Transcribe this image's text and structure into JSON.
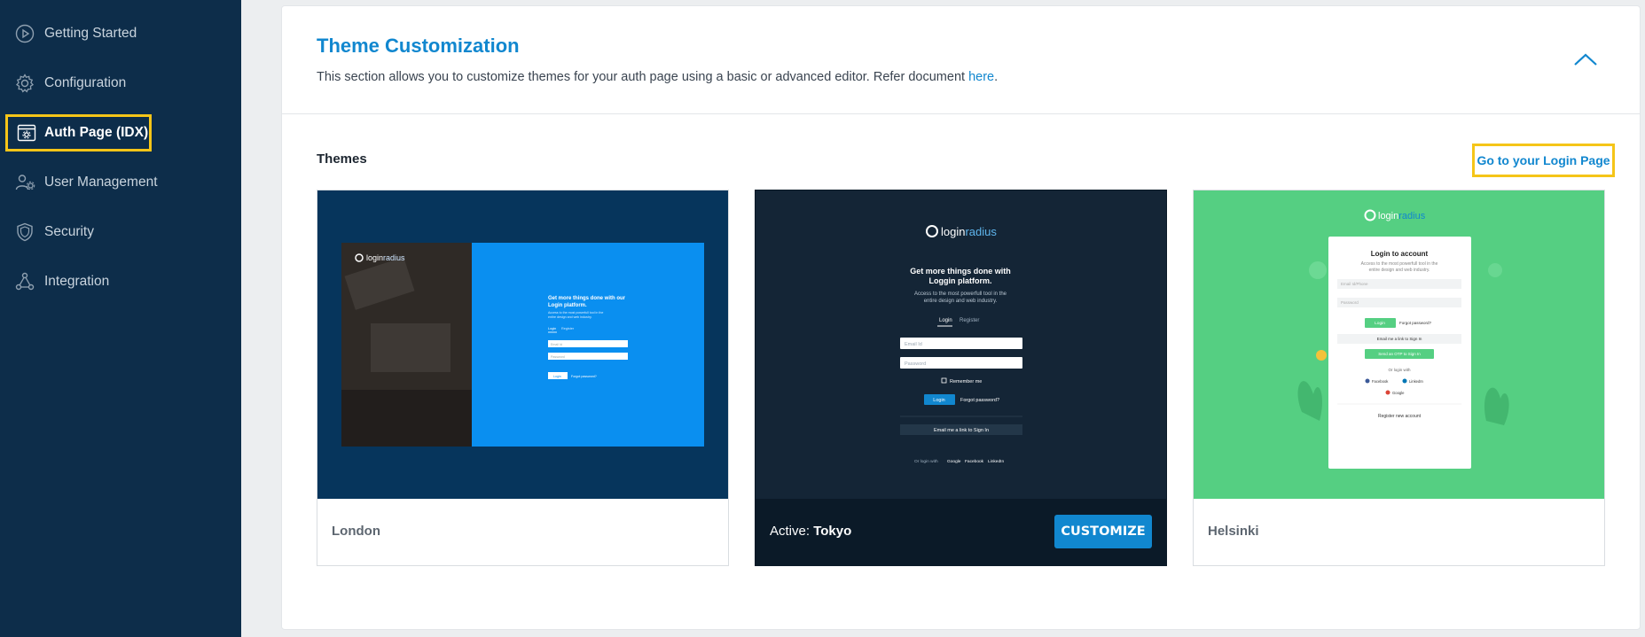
{
  "sidebar": {
    "items": [
      {
        "label": "Getting Started",
        "icon": "play-circle-icon"
      },
      {
        "label": "Configuration",
        "icon": "gear-icon"
      },
      {
        "label": "Auth Page (IDX)",
        "icon": "browser-gear-icon",
        "active": true
      },
      {
        "label": "User Management",
        "icon": "users-gear-icon"
      },
      {
        "label": "Security",
        "icon": "shield-icon"
      },
      {
        "label": "Integration",
        "icon": "integration-nodes-icon"
      }
    ]
  },
  "section": {
    "title": "Theme Customization",
    "description": "This section allows you to customize themes for your auth page using a basic or advanced editor. Refer document ",
    "link_text": "here",
    "description_end": ".",
    "collapse_icon": "chevron-up-icon"
  },
  "themes": {
    "heading": "Themes",
    "login_link": "Go to your Login Page",
    "cards": [
      {
        "name": "London",
        "active": false
      },
      {
        "active_prefix": "Active: ",
        "name": "Tokyo",
        "active": true,
        "button": "CUSTOMIZE"
      },
      {
        "name": "Helsinki",
        "active": false
      }
    ]
  },
  "previews": {
    "logo_a": "login",
    "logo_b": "radius",
    "london": {
      "headline_1": "Get more things done with our",
      "headline_2": "Login platform.",
      "sub_1": "Access to the most powerfull tool in the",
      "sub_2": "entire design and web industry.",
      "tab_login": "Login",
      "tab_register": "Register",
      "email": "Email Id",
      "password": "Password",
      "login_btn": "Login",
      "forgot": "Forgot password?"
    },
    "tokyo": {
      "headline_1": "Get more things done with",
      "headline_2": "Loggin platform.",
      "sub_1": "Access to the most powerfull tool in the",
      "sub_2": "entire design and web industry.",
      "tab_login": "Login",
      "tab_register": "Register",
      "email": "Email Id",
      "password": "Password",
      "remember": "Remember me",
      "login_btn": "Login",
      "forgot": "Forgot password?",
      "email_link": "Email me a link to Sign In",
      "or_login": "Or login with",
      "google": "Google",
      "facebook": "Facebook",
      "linkedin": "LinkedIn"
    },
    "helsinki": {
      "title": "Login to account",
      "sub_1": "Access to the most powerfull tool in the",
      "sub_2": "entire design and web industry.",
      "email": "Email Id/Phone",
      "password": "Password",
      "login_btn": "Login",
      "forgot": "Forgot password?",
      "email_link": "Email me a link to Sign In",
      "otp_btn": "Send an OTP to Sign In",
      "or_login": "Or login with",
      "facebook": "Facebook",
      "linkedin": "LinkedIn",
      "google": "Google",
      "register": "Register new account"
    }
  },
  "colors": {
    "sidebar_bg": "#0d2d4a",
    "accent": "#1187cf",
    "highlight": "#f5c518",
    "london_bg": "#06355c",
    "tokyo_bg": "#142536",
    "helsinki_bg": "#55cf82"
  }
}
